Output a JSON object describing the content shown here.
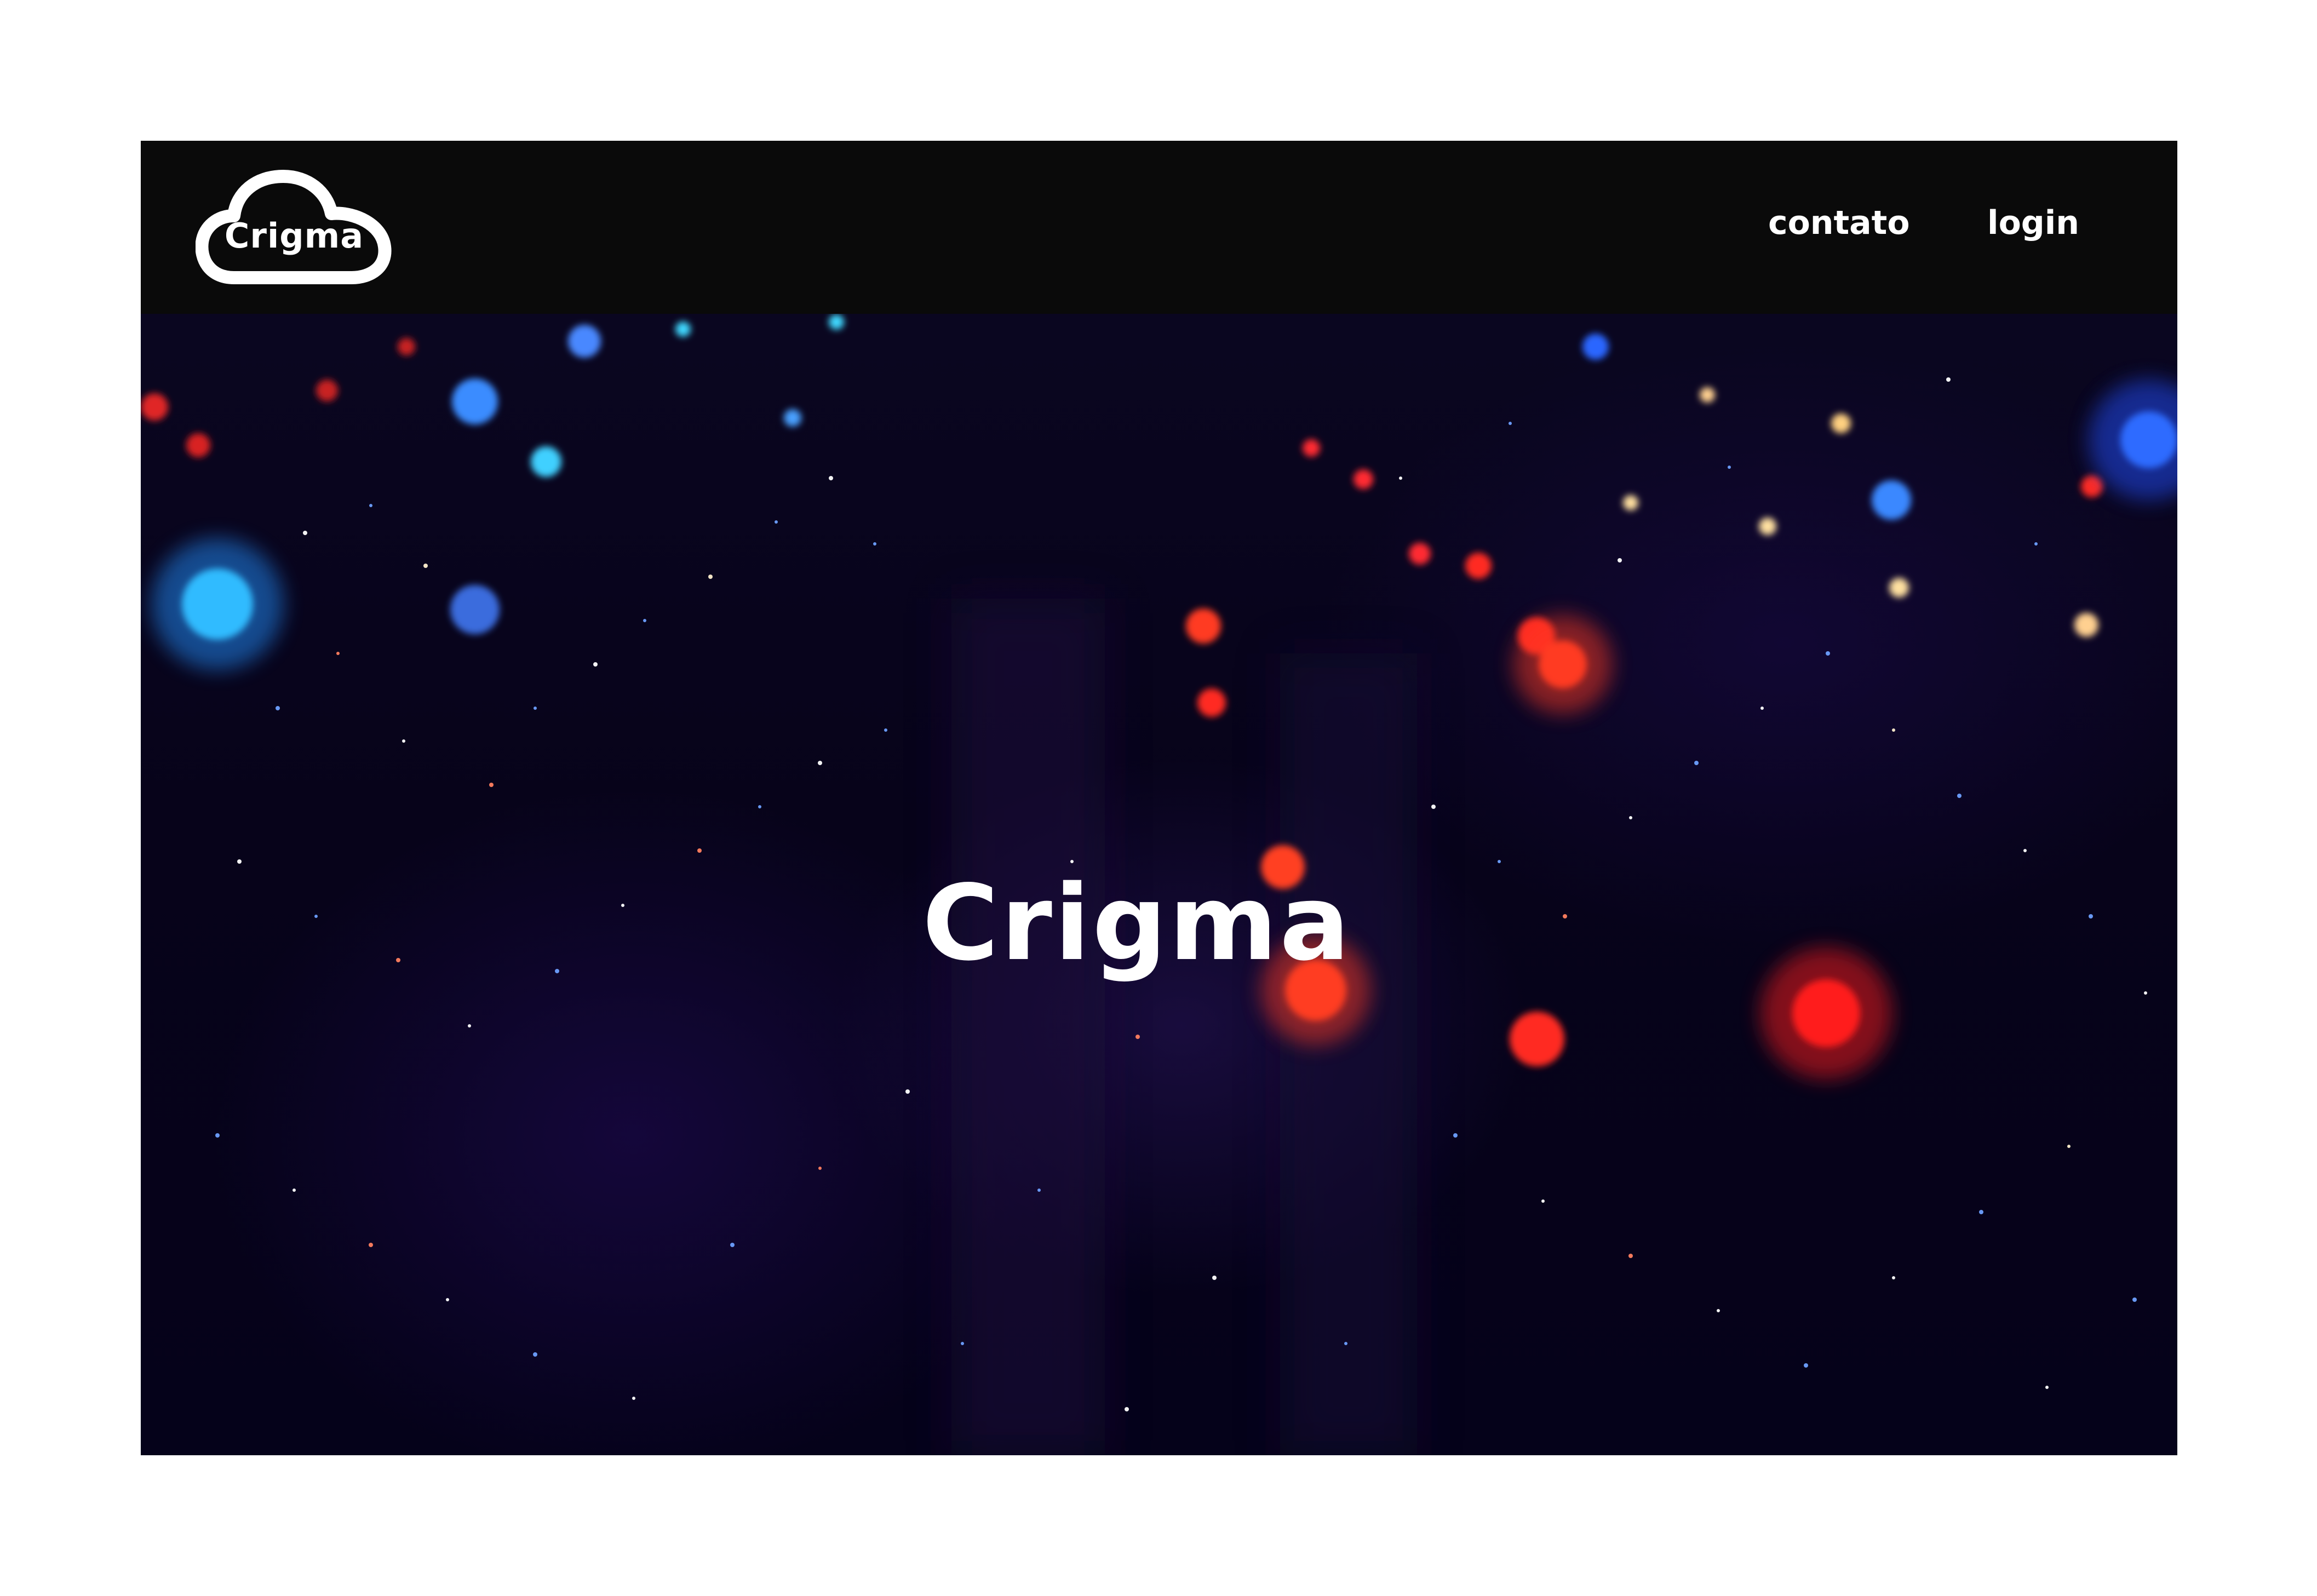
{
  "brand": {
    "logo_text": "Crigma"
  },
  "nav": {
    "contato": "contato",
    "login": "login"
  },
  "hero": {
    "title": "Crigma"
  },
  "colors": {
    "header_bg": "#0a0a0a",
    "hero_bg": "#07031a",
    "text": "#ffffff"
  },
  "icons": {
    "logo": "cloud-logo-icon"
  }
}
